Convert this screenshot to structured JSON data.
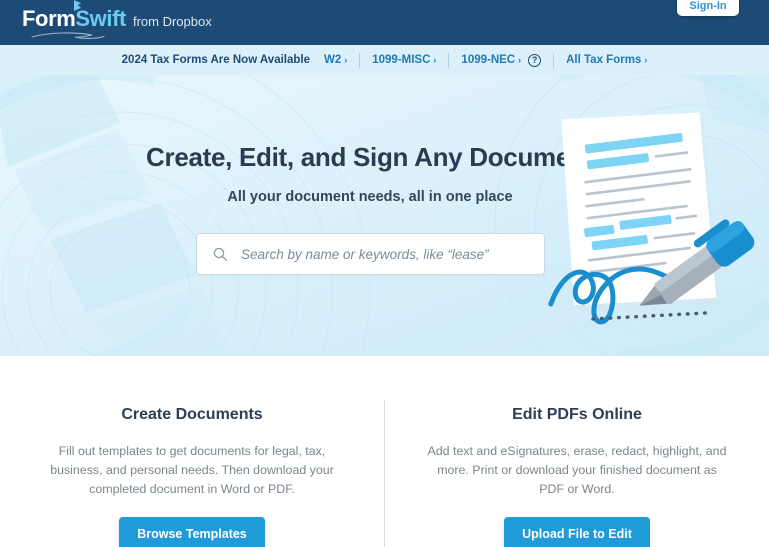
{
  "brand": {
    "logo_form": "Form",
    "logo_swift": "Swift",
    "logo_tagline": "from Dropbox",
    "accent_blue": "#1f9bd9",
    "navy": "#1d4b75",
    "light_blue": "#6cc9ef"
  },
  "topnav": {
    "signin_label": "Sign-In"
  },
  "taxbar": {
    "lead_text": "2024 Tax Forms Are Now Available",
    "links": [
      {
        "label": "W2",
        "chevron": "›"
      },
      {
        "label": "1099-MISC",
        "chevron": "›"
      },
      {
        "label": "1099-NEC",
        "chevron": "›"
      },
      {
        "label": "All Tax Forms",
        "chevron": "›"
      }
    ],
    "help_icon": "question-mark-circle-icon",
    "help_glyph": "?"
  },
  "hero": {
    "title": "Create, Edit, and Sign Any Document",
    "subtitle": "All your document needs, all in one place",
    "search": {
      "placeholder": "Search by name or keywords, like “lease”",
      "value": "",
      "icon": "search-icon"
    },
    "illustration": {
      "name": "signed-document-with-pen-illustration",
      "paper_color": "#ffffff",
      "highlight_color": "#7dd4f5",
      "line_color": "#b9c4cf",
      "signature_color": "#1a8fd0",
      "pen_body_color": "#8d99a6",
      "pen_cap_color": "#1a8fd0"
    }
  },
  "bottom": {
    "columns": [
      {
        "title": "Create Documents",
        "description": "Fill out templates to get documents for legal, tax, business, and personal needs. Then download your completed document in Word or PDF.",
        "cta_label": "Browse Templates"
      },
      {
        "title": "Edit PDFs Online",
        "description": "Add text and eSignatures, erase, redact, highlight, and more. Print or download your finished document as PDF or Word.",
        "cta_label": "Upload File to Edit"
      }
    ]
  }
}
